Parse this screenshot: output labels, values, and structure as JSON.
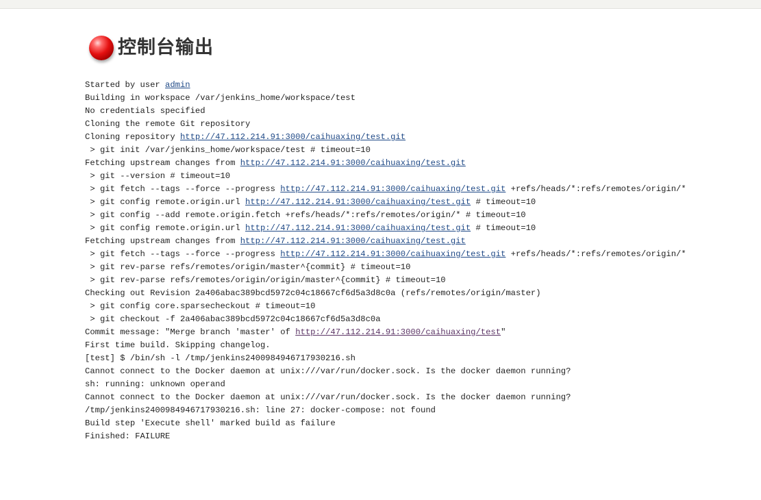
{
  "page": {
    "title": "控制台输出",
    "status_icon": "red-ball-icon",
    "status_color": "#e41010"
  },
  "console": {
    "started_prefix": "Started by user ",
    "started_user": "admin",
    "lines": [
      {
        "segments": [
          {
            "text": "Started by user "
          },
          {
            "text": "admin",
            "link": true
          }
        ]
      },
      {
        "segments": [
          {
            "text": "Building in workspace /var/jenkins_home/workspace/test"
          }
        ]
      },
      {
        "segments": [
          {
            "text": "No credentials specified"
          }
        ]
      },
      {
        "segments": [
          {
            "text": "Cloning the remote Git repository"
          }
        ]
      },
      {
        "segments": [
          {
            "text": "Cloning repository "
          },
          {
            "text": "http://47.112.214.91:3000/caihuaxing/test.git",
            "link": true
          }
        ]
      },
      {
        "segments": [
          {
            "text": " > git init /var/jenkins_home/workspace/test # timeout=10"
          }
        ]
      },
      {
        "segments": [
          {
            "text": "Fetching upstream changes from "
          },
          {
            "text": "http://47.112.214.91:3000/caihuaxing/test.git",
            "link": true
          }
        ]
      },
      {
        "segments": [
          {
            "text": " > git --version # timeout=10"
          }
        ]
      },
      {
        "segments": [
          {
            "text": " > git fetch --tags --force --progress "
          },
          {
            "text": "http://47.112.214.91:3000/caihuaxing/test.git",
            "link": true
          },
          {
            "text": " +refs/heads/*:refs/remotes/origin/*"
          }
        ]
      },
      {
        "segments": [
          {
            "text": " > git config remote.origin.url "
          },
          {
            "text": "http://47.112.214.91:3000/caihuaxing/test.git",
            "link": true
          },
          {
            "text": " # timeout=10"
          }
        ]
      },
      {
        "segments": [
          {
            "text": " > git config --add remote.origin.fetch +refs/heads/*:refs/remotes/origin/* # timeout=10"
          }
        ]
      },
      {
        "segments": [
          {
            "text": " > git config remote.origin.url "
          },
          {
            "text": "http://47.112.214.91:3000/caihuaxing/test.git",
            "link": true
          },
          {
            "text": " # timeout=10"
          }
        ]
      },
      {
        "segments": [
          {
            "text": "Fetching upstream changes from "
          },
          {
            "text": "http://47.112.214.91:3000/caihuaxing/test.git",
            "link": true
          }
        ]
      },
      {
        "segments": [
          {
            "text": " > git fetch --tags --force --progress "
          },
          {
            "text": "http://47.112.214.91:3000/caihuaxing/test.git",
            "link": true
          },
          {
            "text": " +refs/heads/*:refs/remotes/origin/*"
          }
        ]
      },
      {
        "segments": [
          {
            "text": " > git rev-parse refs/remotes/origin/master^{commit} # timeout=10"
          }
        ]
      },
      {
        "segments": [
          {
            "text": " > git rev-parse refs/remotes/origin/origin/master^{commit} # timeout=10"
          }
        ]
      },
      {
        "segments": [
          {
            "text": "Checking out Revision 2a406abac389bcd5972c04c18667cf6d5a3d8c0a (refs/remotes/origin/master)"
          }
        ]
      },
      {
        "segments": [
          {
            "text": " > git config core.sparsecheckout # timeout=10"
          }
        ]
      },
      {
        "segments": [
          {
            "text": " > git checkout -f 2a406abac389bcd5972c04c18667cf6d5a3d8c0a"
          }
        ]
      },
      {
        "segments": [
          {
            "text": "Commit message: \"Merge branch 'master' of "
          },
          {
            "text": "http://47.112.214.91:3000/caihuaxing/test",
            "link": true,
            "visited": true
          },
          {
            "text": "\""
          }
        ]
      },
      {
        "segments": [
          {
            "text": "First time build. Skipping changelog."
          }
        ]
      },
      {
        "segments": [
          {
            "text": "[test] $ /bin/sh -l /tmp/jenkins2400984946717930216.sh"
          }
        ]
      },
      {
        "segments": [
          {
            "text": "Cannot connect to the Docker daemon at unix:///var/run/docker.sock. Is the docker daemon running?"
          }
        ]
      },
      {
        "segments": [
          {
            "text": "sh: running: unknown operand"
          }
        ]
      },
      {
        "segments": [
          {
            "text": "Cannot connect to the Docker daemon at unix:///var/run/docker.sock. Is the docker daemon running?"
          }
        ]
      },
      {
        "segments": [
          {
            "text": "/tmp/jenkins2400984946717930216.sh: line 27: docker-compose: not found"
          }
        ]
      },
      {
        "segments": [
          {
            "text": "Build step 'Execute shell' marked build as failure"
          }
        ]
      },
      {
        "segments": [
          {
            "text": "Finished: FAILURE"
          }
        ]
      }
    ]
  }
}
